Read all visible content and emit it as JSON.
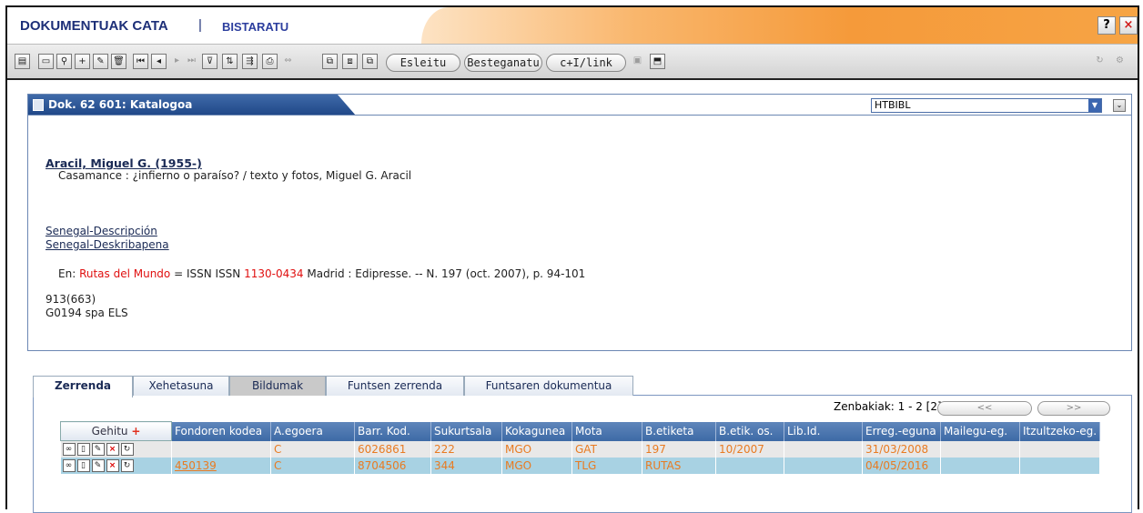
{
  "header": {
    "title": "DOKUMENTUAK CATA",
    "separator": "|",
    "subtitle": "BISTARATU",
    "help": "?",
    "close": "×"
  },
  "toolbar": {
    "pills": [
      "Esleitu",
      "Besteganatu",
      "c+I/link"
    ]
  },
  "panel": {
    "title": "Dok. 62 601: Katalogoa",
    "dropdown_value": "HTBIBL",
    "author": "Aracil, Miguel G. (1955-)",
    "title_statement": "Casamance : ¿infierno o paraíso? / texto y fotos, Miguel G. Aracil",
    "subject1": "Senegal-Descripción",
    "subject2": "Senegal-Deskribapena",
    "en_prefix": "En:",
    "en_journal": "Rutas del Mundo",
    "en_mid": "= ISSN ISSN",
    "en_issn": "1130-0434",
    "en_rest": "Madrid : Edipresse. -- N. 197 (oct. 2007), p. 94-101",
    "cdu": "913(663)",
    "code": "G0194 spa ELS"
  },
  "tabs": [
    "Zerrenda",
    "Xehetasuna",
    "Bildumak",
    "Funtsen zerrenda",
    "Funtsaren dokumentua"
  ],
  "pager": {
    "label": "Zenbakiak: 1 - 2 [2]",
    "prev": "<<",
    "next": ">>"
  },
  "grid": {
    "add_label": "Gehitu",
    "add_symbol": "+",
    "columns": [
      "Fondoren kodea",
      "A.egoera",
      "Barr. Kod.",
      "Sukurtsala",
      "Kokagunea",
      "Mota",
      "B.etiketa",
      "B.etik. os.",
      "Lib.Id.",
      "Erreg.-eguna",
      "Mailegu-eg.",
      "Itzultzeko-eg."
    ],
    "rows": [
      [
        "",
        "C",
        "6026861",
        "222",
        "MGO",
        "GAT",
        "197",
        "10/2007",
        "",
        "31/03/2008",
        "",
        ""
      ],
      [
        "450139",
        "C",
        "8704506",
        "344",
        "MGO",
        "TLG",
        "RUTAS",
        "",
        "",
        "04/05/2016",
        "",
        ""
      ]
    ]
  }
}
